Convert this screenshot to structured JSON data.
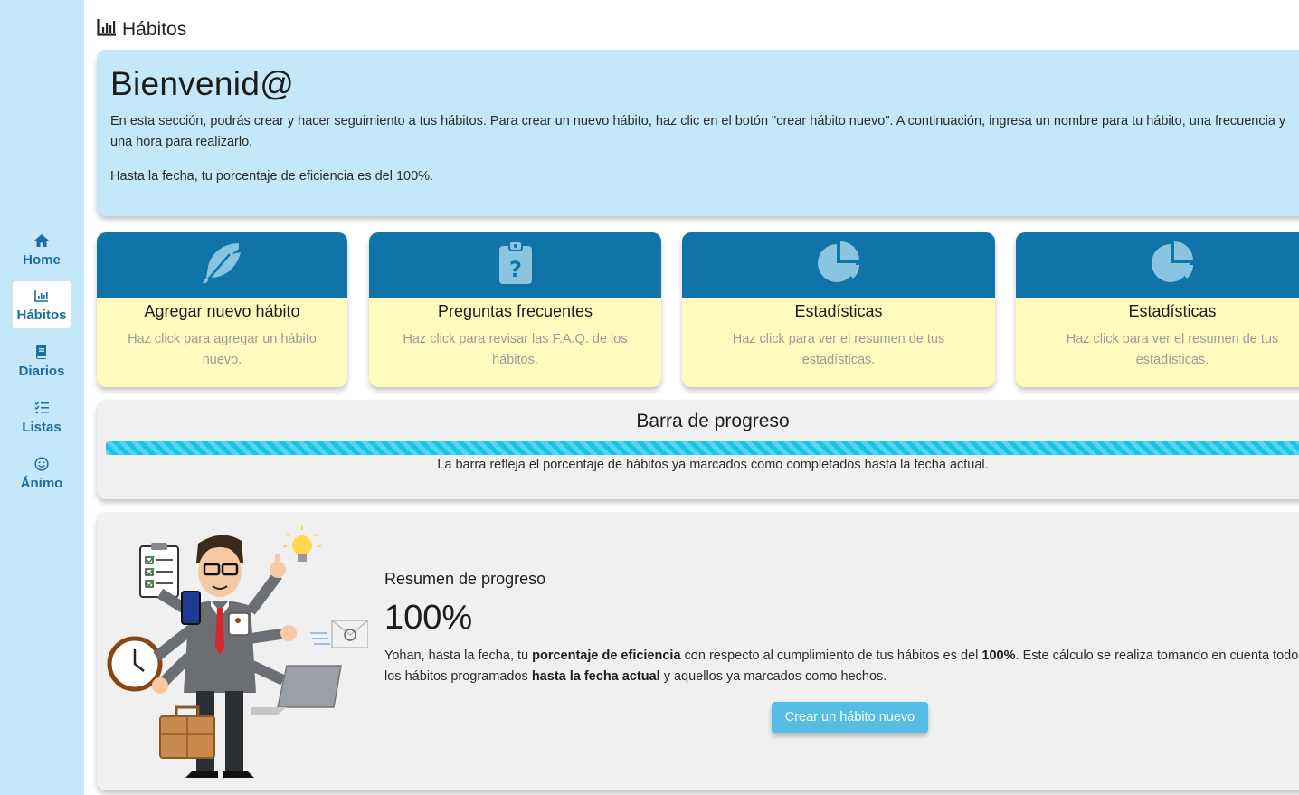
{
  "sidebar": {
    "items": [
      {
        "label": "Home",
        "icon": "home-icon",
        "active": false
      },
      {
        "label": "Hábitos",
        "icon": "bar-chart-icon",
        "active": true
      },
      {
        "label": "Diarios",
        "icon": "book-icon",
        "active": false
      },
      {
        "label": "Listas",
        "icon": "list-check-icon",
        "active": false
      },
      {
        "label": "Ánimo",
        "icon": "smile-icon",
        "active": false
      }
    ]
  },
  "header": {
    "title": "Hábitos",
    "icon": "bar-chart-icon"
  },
  "welcome": {
    "title": "Bienvenid@",
    "intro": "En esta sección, podrás crear y hacer seguimiento a tus hábitos. Para crear un nuevo hábito, haz clic en el botón \"crear hábito nuevo\". A continuación, ingresa un nombre para tu hábito, una frecuencia y una hora para realizarlo.",
    "efficiency": "Hasta la fecha, tu porcentaje de eficiencia es del 100%."
  },
  "cards": [
    {
      "title": "Agregar nuevo hábito",
      "desc": "Haz click para agregar un hábito nuevo.",
      "icon": "feather-icon"
    },
    {
      "title": "Preguntas frecuentes",
      "desc": "Haz click para revisar las F.A.Q. de los hábitos.",
      "icon": "clipboard-question-icon"
    },
    {
      "title": "Estadísticas",
      "desc": "Haz click para ver el resumen de tus estadísticas.",
      "icon": "pie-chart-icon"
    },
    {
      "title": "Estadísticas",
      "desc": "Haz click para ver el resumen de tus estadísticas.",
      "icon": "pie-chart-icon"
    }
  ],
  "progress": {
    "title": "Barra de progreso",
    "value": 100,
    "note": "La barra refleja el porcentaje de hábitos ya marcados como completados hasta la fecha actual."
  },
  "summary": {
    "title": "Resumen de progreso",
    "percent": "100%",
    "t1": "Yohan, hasta la fecha, tu ",
    "b1": "porcentaje de eficiencia",
    "t2": " con respecto al cumplimiento de tus hábitos es del ",
    "b2": "100%",
    "t3": ". Este cálculo se realiza tomando en cuenta todos los hábitos programados ",
    "b3": "hasta la fecha actual",
    "t4": " y aquellos ya marcados como hechos.",
    "button": "Crear un hábito nuevo"
  },
  "colors": {
    "sidebar": "#c4e7f9",
    "card_header": "#1074a8",
    "card_body": "#fffbbe",
    "progress": "#19c3e8",
    "button": "#56bde6"
  }
}
